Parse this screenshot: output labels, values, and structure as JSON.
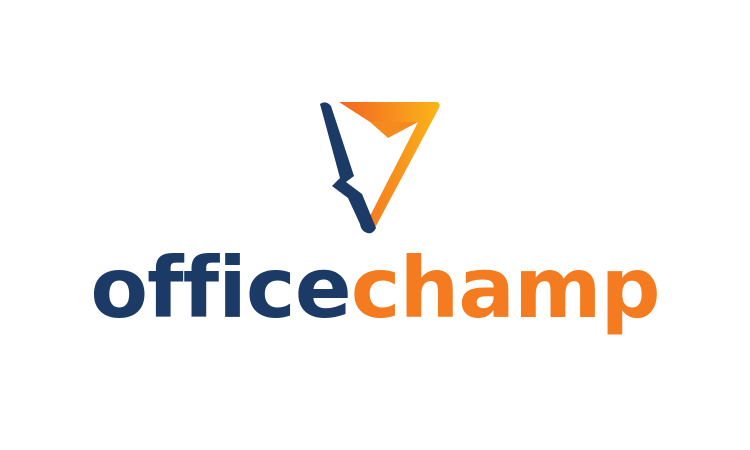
{
  "logo": {
    "word_part_1": "office",
    "word_part_2": "champ",
    "icon": "stylized-v-pennant-icon"
  },
  "colors": {
    "background": "#ffffff",
    "navy": "#1b3a66",
    "orange": "#f47b20",
    "orange_light": "#f7941d",
    "yellow": "#fbb617"
  }
}
